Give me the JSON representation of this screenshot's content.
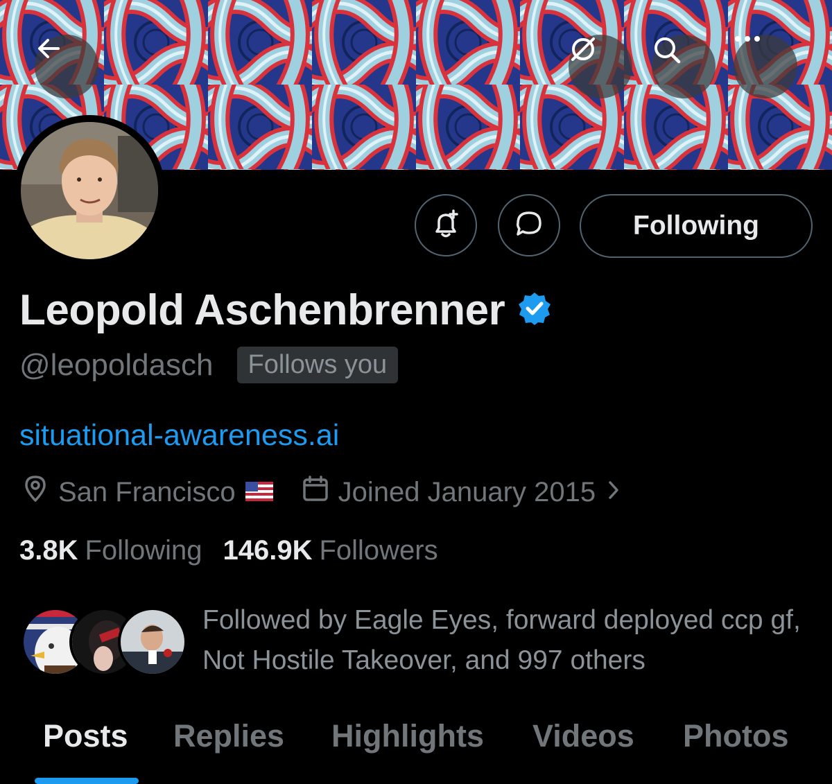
{
  "header": {
    "back_icon": "arrow-left-icon",
    "buttons": [
      "grok-icon",
      "search-icon",
      "more-icon"
    ]
  },
  "profile": {
    "name": "Leopold Aschenbrenner",
    "verified": true,
    "handle": "@leopoldasch",
    "follows_you": "Follows you",
    "link": "situational-awareness.ai",
    "location": "San Francisco",
    "joined": "Joined January 2015",
    "following_count": "3.8K",
    "following_label": "Following",
    "followers_count": "146.9K",
    "followers_label": "Followers",
    "followed_by": "Followed by Eagle Eyes, forward deployed ccp gf, Not Hostile Takeover, and 997 others"
  },
  "actions": {
    "following_button": "Following"
  },
  "tabs": [
    {
      "label": "Posts",
      "active": true
    },
    {
      "label": "Replies",
      "active": false
    },
    {
      "label": "Highlights",
      "active": false
    },
    {
      "label": "Videos",
      "active": false
    },
    {
      "label": "Photos",
      "active": false
    }
  ],
  "colors": {
    "accent": "#1d9bf0",
    "background": "#000000",
    "text_primary": "#e7e9ea",
    "text_secondary": "#71767b"
  }
}
